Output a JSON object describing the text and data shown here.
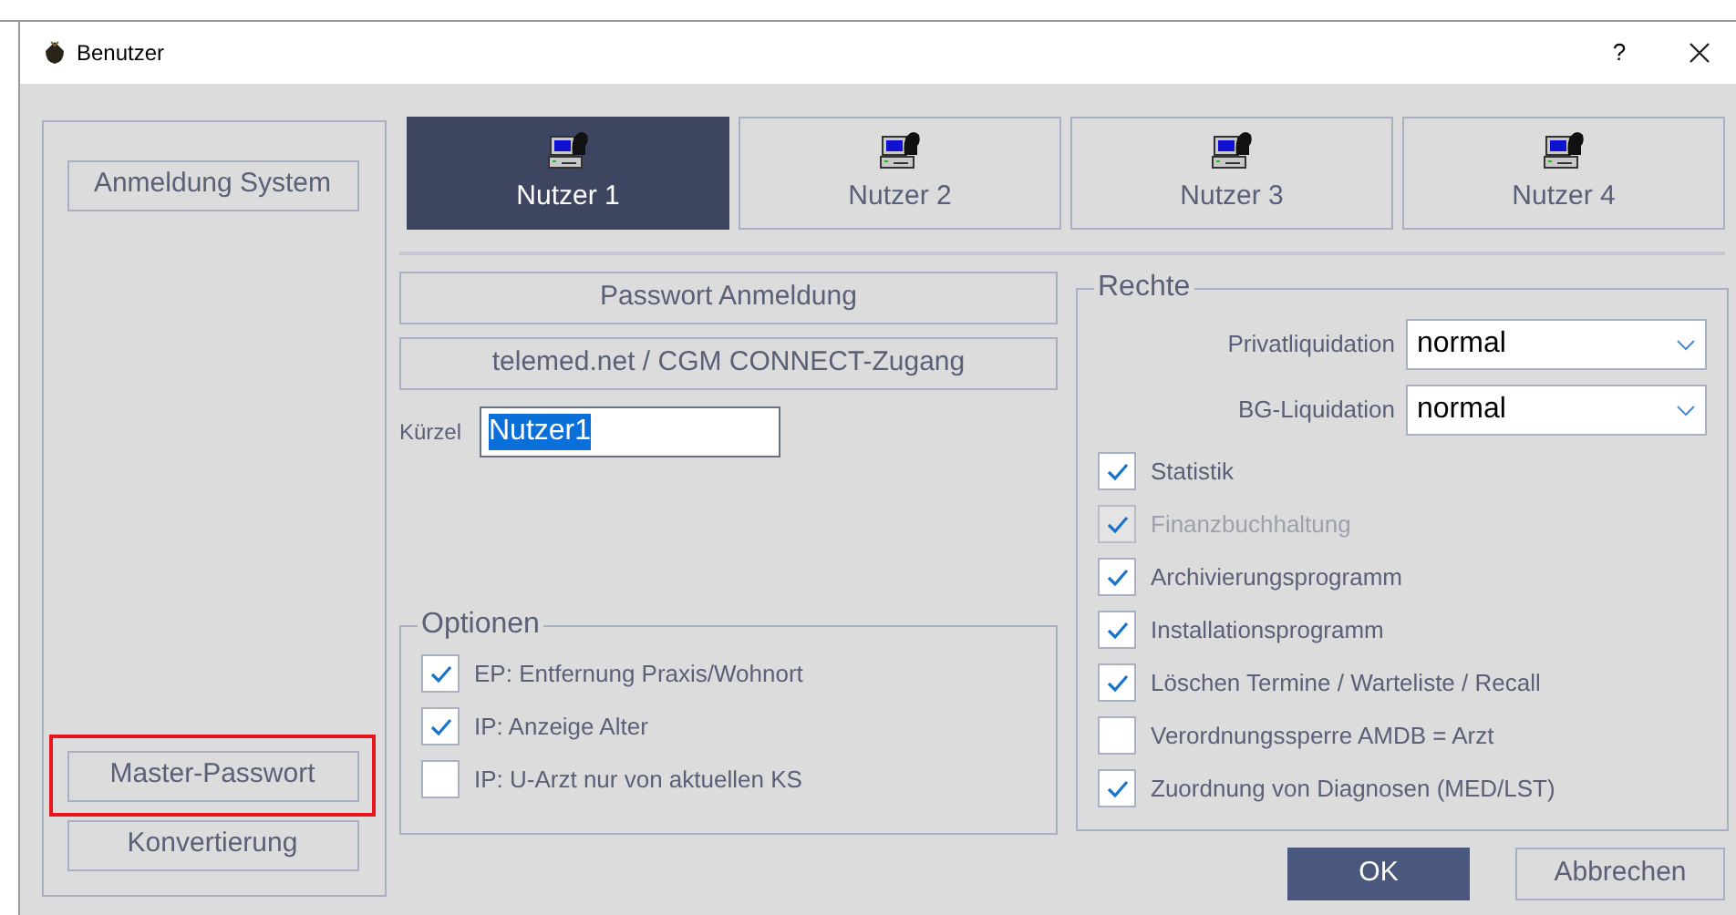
{
  "window": {
    "title": "Benutzer",
    "help": "?"
  },
  "side_buttons": [
    {
      "label": "Anmeldung System",
      "highlighted": false
    },
    {
      "label": "Master-Passwort",
      "highlighted": true
    },
    {
      "label": "Konvertierung",
      "highlighted": false
    }
  ],
  "tabs": [
    {
      "label": "Nutzer 1",
      "selected": true
    },
    {
      "label": "Nutzer 2",
      "selected": false
    },
    {
      "label": "Nutzer 3",
      "selected": false
    },
    {
      "label": "Nutzer 4",
      "selected": false
    }
  ],
  "actions": [
    "Passwort Anmeldung",
    "telemed.net / CGM CONNECT-Zugang"
  ],
  "kuerzel": {
    "label": "Kürzel",
    "value": "Nutzer1"
  },
  "optionen": {
    "title": "Optionen",
    "items": [
      {
        "label": "EP: Entfernung Praxis/Wohnort",
        "checked": true,
        "disabled": false
      },
      {
        "label": "IP: Anzeige Alter",
        "checked": true,
        "disabled": false
      },
      {
        "label": "IP: U-Arzt nur von aktuellen KS",
        "checked": false,
        "disabled": false
      }
    ]
  },
  "rechte": {
    "title": "Rechte",
    "selects": [
      {
        "label": "Privatliquidation",
        "value": "normal"
      },
      {
        "label": "BG-Liquidation",
        "value": "normal"
      }
    ],
    "items": [
      {
        "label": "Statistik",
        "checked": true,
        "disabled": false
      },
      {
        "label": "Finanzbuchhaltung",
        "checked": true,
        "disabled": true
      },
      {
        "label": "Archivierungsprogramm",
        "checked": true,
        "disabled": false
      },
      {
        "label": "Installationsprogramm",
        "checked": true,
        "disabled": false
      },
      {
        "label": "Löschen Termine / Warteliste / Recall",
        "checked": true,
        "disabled": false
      },
      {
        "label": "Verordnungssperre AMDB = Arzt",
        "checked": false,
        "disabled": false
      },
      {
        "label": "Zuordnung von Diagnosen (MED/LST)",
        "checked": true,
        "disabled": false
      }
    ]
  },
  "buttons": [
    {
      "label": "OK",
      "kind": "primary"
    },
    {
      "label": "Abbrechen",
      "kind": "secondary"
    }
  ]
}
